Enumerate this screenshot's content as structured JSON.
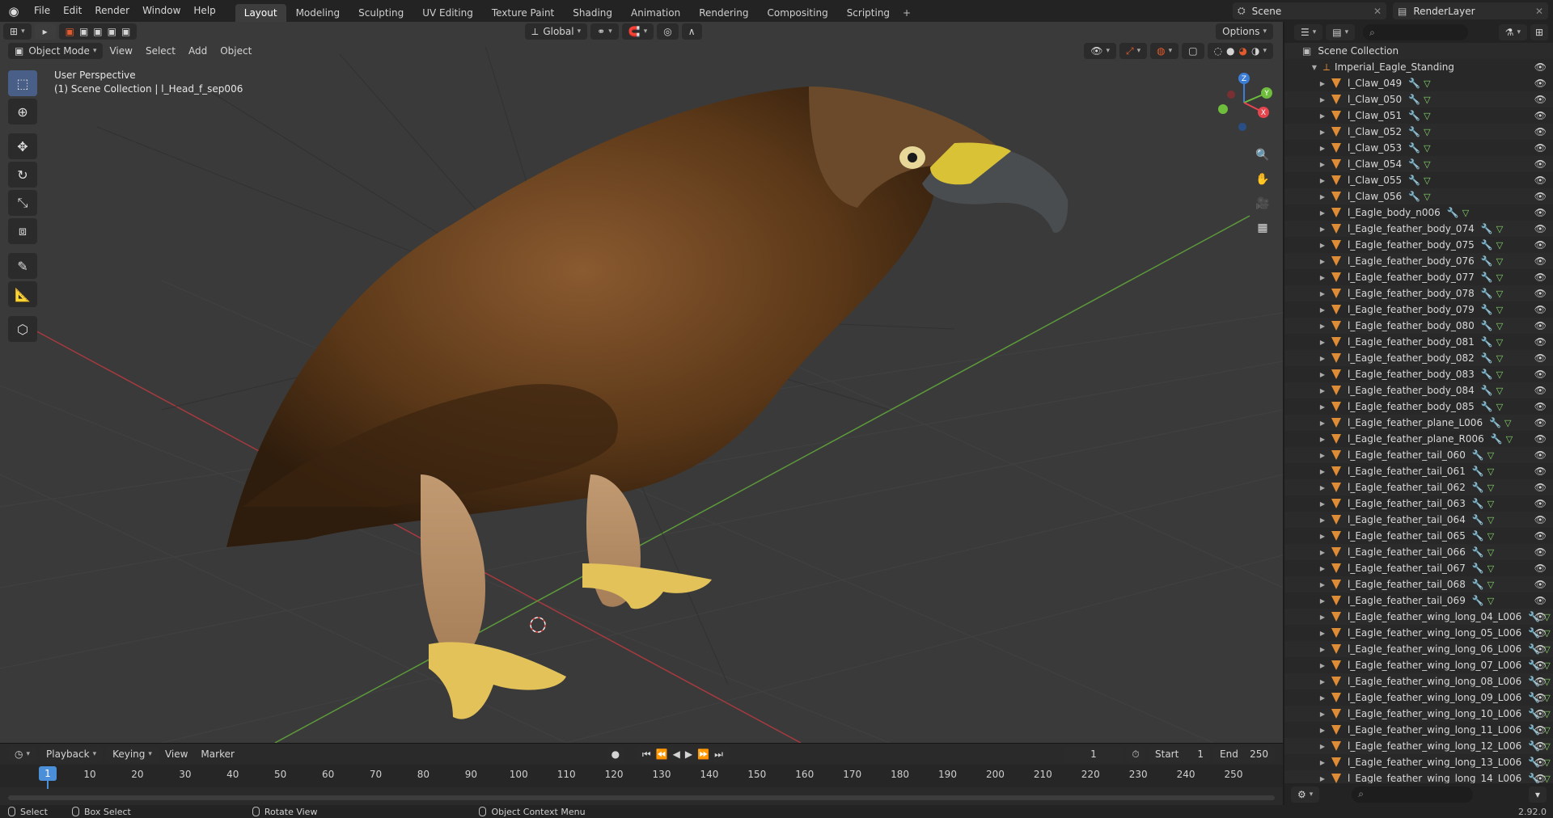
{
  "menu": [
    "File",
    "Edit",
    "Render",
    "Window",
    "Help"
  ],
  "workspaces": [
    {
      "label": "Layout",
      "active": true
    },
    {
      "label": "Modeling"
    },
    {
      "label": "Sculpting"
    },
    {
      "label": "UV Editing"
    },
    {
      "label": "Texture Paint"
    },
    {
      "label": "Shading"
    },
    {
      "label": "Animation"
    },
    {
      "label": "Rendering"
    },
    {
      "label": "Compositing"
    },
    {
      "label": "Scripting"
    }
  ],
  "scene": "Scene",
  "render_layer": "RenderLayer",
  "viewport": {
    "mode": "Object Mode",
    "menus": [
      "View",
      "Select",
      "Add",
      "Object"
    ],
    "transform_orientation": "Global",
    "options_label": "Options",
    "perspective": "User Perspective",
    "active_info": "(1) Scene Collection | l_Head_f_sep006"
  },
  "timeline": {
    "menus": [
      "Playback",
      "Keying",
      "View",
      "Marker"
    ],
    "current_frame": "1",
    "start_label": "Start",
    "start": "1",
    "end_label": "End",
    "end": "250",
    "ticks": [
      "10",
      "20",
      "30",
      "40",
      "50",
      "60",
      "70",
      "80",
      "90",
      "100",
      "110",
      "120",
      "130",
      "140",
      "150",
      "160",
      "170",
      "180",
      "190",
      "200",
      "210",
      "220",
      "230",
      "240",
      "250"
    ],
    "playhead": "1"
  },
  "status": {
    "select": "Select",
    "box_select": "Box Select",
    "rotate_view": "Rotate View",
    "context_menu": "Object Context Menu",
    "version": "2.92.0"
  },
  "outliner": {
    "root": "Scene Collection",
    "collection": "Imperial_Eagle_Standing",
    "items": [
      "l_Claw_049",
      "l_Claw_050",
      "l_Claw_051",
      "l_Claw_052",
      "l_Claw_053",
      "l_Claw_054",
      "l_Claw_055",
      "l_Claw_056",
      "l_Eagle_body_n006",
      "l_Eagle_feather_body_074",
      "l_Eagle_feather_body_075",
      "l_Eagle_feather_body_076",
      "l_Eagle_feather_body_077",
      "l_Eagle_feather_body_078",
      "l_Eagle_feather_body_079",
      "l_Eagle_feather_body_080",
      "l_Eagle_feather_body_081",
      "l_Eagle_feather_body_082",
      "l_Eagle_feather_body_083",
      "l_Eagle_feather_body_084",
      "l_Eagle_feather_body_085",
      "l_Eagle_feather_plane_L006",
      "l_Eagle_feather_plane_R006",
      "l_Eagle_feather_tail_060",
      "l_Eagle_feather_tail_061",
      "l_Eagle_feather_tail_062",
      "l_Eagle_feather_tail_063",
      "l_Eagle_feather_tail_064",
      "l_Eagle_feather_tail_065",
      "l_Eagle_feather_tail_066",
      "l_Eagle_feather_tail_067",
      "l_Eagle_feather_tail_068",
      "l_Eagle_feather_tail_069",
      "l_Eagle_feather_wing_long_04_L006",
      "l_Eagle_feather_wing_long_05_L006",
      "l_Eagle_feather_wing_long_06_L006",
      "l_Eagle_feather_wing_long_07_L006",
      "l_Eagle_feather_wing_long_08_L006",
      "l_Eagle_feather_wing_long_09_L006",
      "l_Eagle_feather_wing_long_10_L006",
      "l_Eagle_feather_wing_long_11_L006",
      "l_Eagle_feather_wing_long_12_L006",
      "l_Eagle_feather_wing_long_13_L006",
      "l_Eagle_feather_wing_long_14_L006"
    ]
  },
  "colors": {
    "accent": "#4a5f88",
    "object_icon": "#e08b36",
    "axis_x": "#e5454d",
    "axis_y": "#6fbd3c",
    "axis_z": "#3c7ed6"
  }
}
